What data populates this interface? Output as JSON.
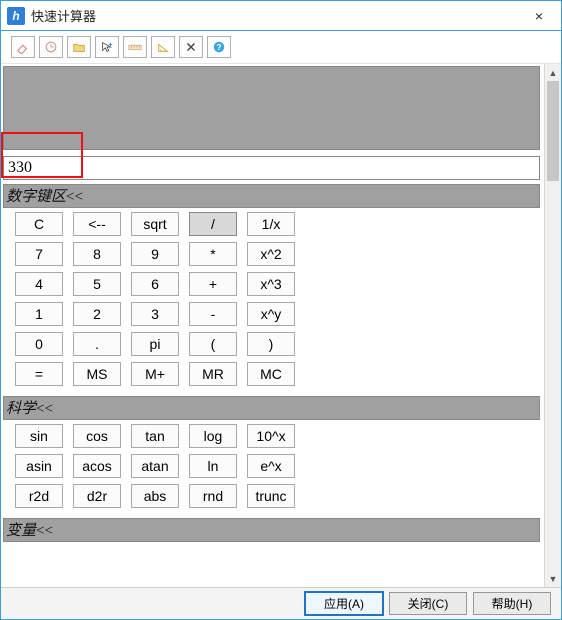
{
  "window": {
    "title": "快速计算器",
    "close_icon": "×"
  },
  "toolbar": {
    "items": [
      {
        "name": "eraser-icon"
      },
      {
        "name": "clock-icon"
      },
      {
        "name": "folder-icon"
      },
      {
        "name": "pointer-plus-icon"
      },
      {
        "name": "ruler-icon"
      },
      {
        "name": "angle-icon"
      },
      {
        "name": "clear-x-icon"
      },
      {
        "name": "help-icon"
      }
    ]
  },
  "input": {
    "value": "330"
  },
  "sections": {
    "numeric": {
      "title": "数字键区",
      "collapse": "<<",
      "rows": [
        [
          "C",
          "<--",
          "sqrt",
          "/",
          "1/x"
        ],
        [
          "7",
          "8",
          "9",
          "*",
          "x^2"
        ],
        [
          "4",
          "5",
          "6",
          "+",
          "x^3"
        ],
        [
          "1",
          "2",
          "3",
          "-",
          "x^y"
        ],
        [
          "0",
          ".",
          "pi",
          "(",
          ")"
        ],
        [
          "=",
          "MS",
          "M+",
          "MR",
          "MC"
        ]
      ],
      "pressed": [
        0,
        3
      ]
    },
    "scientific": {
      "title": "科学",
      "collapse": "<<",
      "rows": [
        [
          "sin",
          "cos",
          "tan",
          "log",
          "10^x"
        ],
        [
          "asin",
          "acos",
          "atan",
          "ln",
          "e^x"
        ],
        [
          "r2d",
          "d2r",
          "abs",
          "rnd",
          "trunc"
        ]
      ]
    },
    "variables": {
      "title": "变量",
      "collapse": "<<"
    }
  },
  "footer": {
    "apply": "应用(A)",
    "close": "关闭(C)",
    "help": "帮助(H)"
  }
}
